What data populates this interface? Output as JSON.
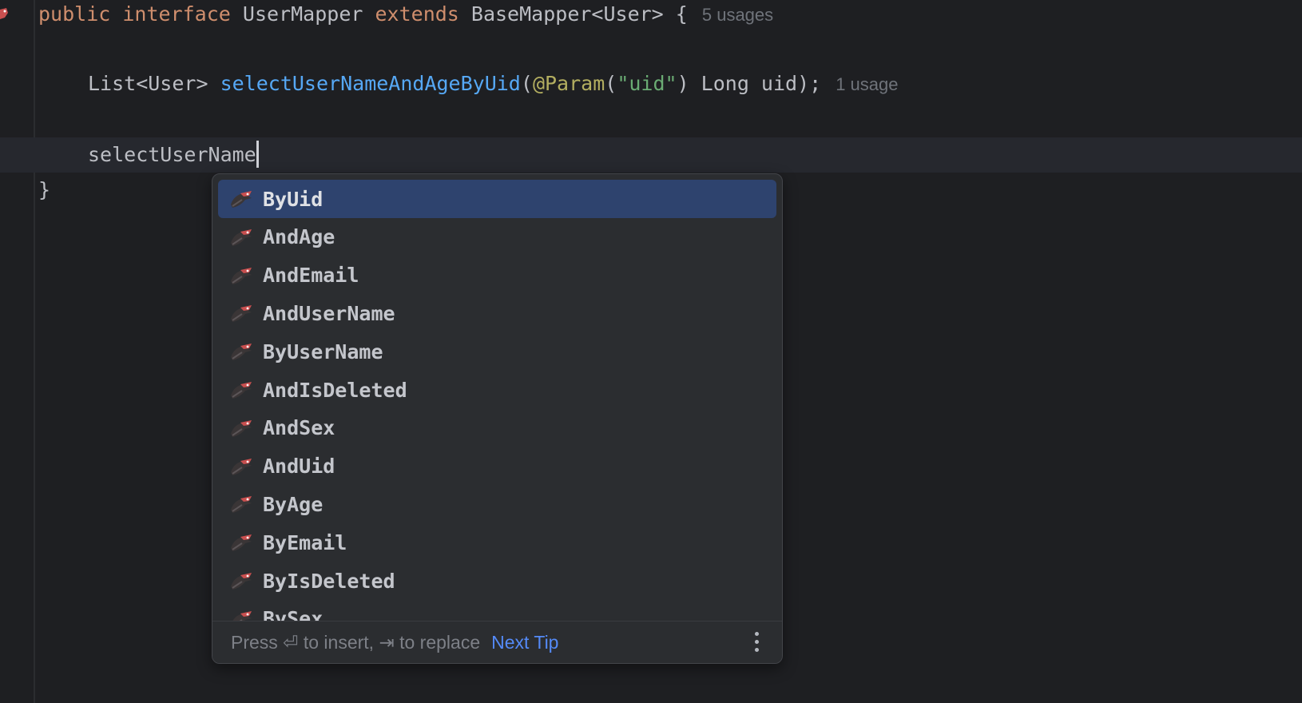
{
  "code": {
    "line1": {
      "public": "public",
      "interface": "interface",
      "name": "UserMapper",
      "extends": "extends",
      "base": "BaseMapper<User>",
      "brace": "{",
      "usages": "5 usages"
    },
    "line2": {
      "return_type": "List<User>",
      "method": "selectUserNameAndAgeByUid",
      "open_paren": "(",
      "annotation": "@Param",
      "paren2": "(",
      "string": "\"uid\"",
      "rest": ") Long uid);",
      "usages": "1 usage"
    },
    "line3": {
      "typed": "selectUserName"
    },
    "line4": {
      "close": "}"
    }
  },
  "completion": {
    "items": [
      {
        "label": "ByUid",
        "selected": true
      },
      {
        "label": "AndAge"
      },
      {
        "label": "AndEmail"
      },
      {
        "label": "AndUserName"
      },
      {
        "label": "ByUserName"
      },
      {
        "label": "AndIsDeleted"
      },
      {
        "label": "AndSex"
      },
      {
        "label": "AndUid"
      },
      {
        "label": "ByAge"
      },
      {
        "label": "ByEmail"
      },
      {
        "label": "ByIsDeleted"
      },
      {
        "label": "BySex"
      }
    ],
    "footer": {
      "hint": "Press ⏎ to insert, ⇥ to replace",
      "next_tip": "Next Tip"
    },
    "icon": "mybatis-bird-icon"
  },
  "colors": {
    "background": "#1e1f22",
    "keyword": "#cf8e6d",
    "method": "#56a8f5",
    "annotation": "#b3ae60",
    "string": "#6aab73",
    "selection": "#2e436e",
    "link": "#548af7"
  }
}
